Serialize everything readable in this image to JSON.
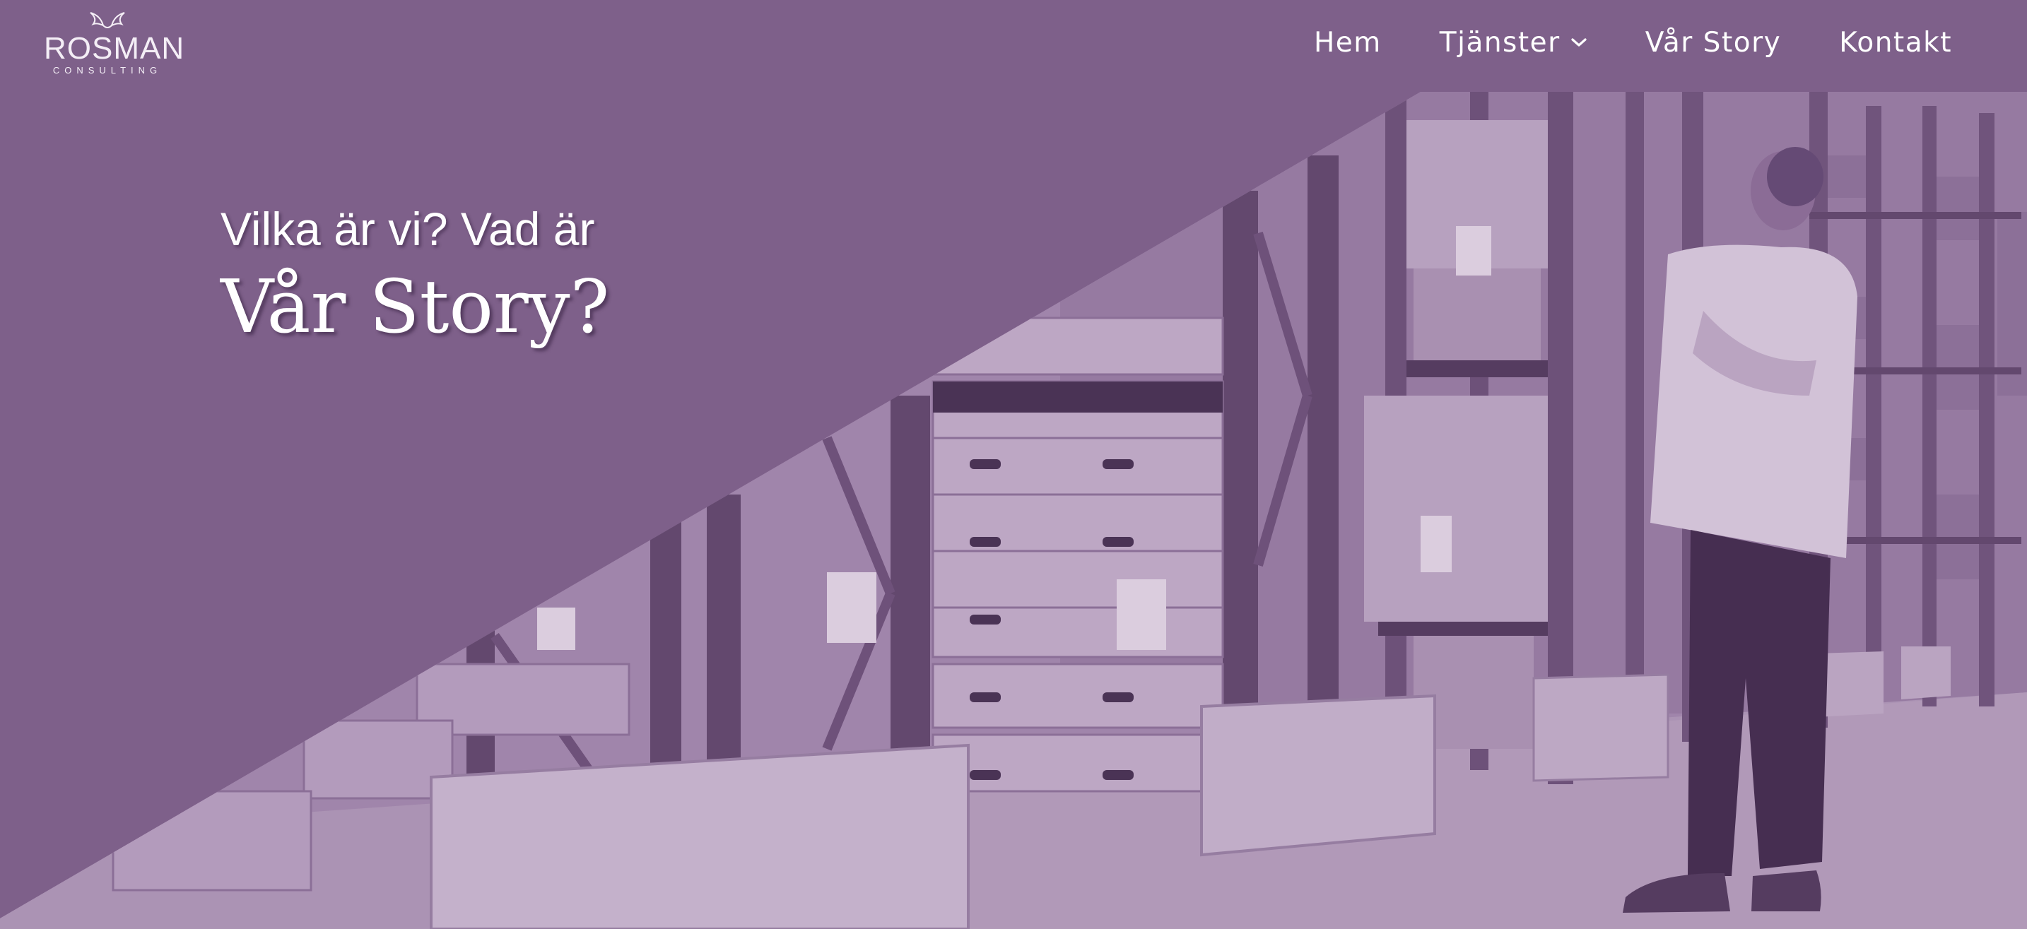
{
  "brand": {
    "name": "ROSMAN",
    "tagline": "CONSULTING"
  },
  "nav": {
    "items": [
      {
        "label": "Hem"
      },
      {
        "label": "Tjänster",
        "icon": "chevron-down-icon"
      },
      {
        "label": "Vår Story"
      },
      {
        "label": "Kontakt"
      }
    ]
  },
  "hero": {
    "kicker": "Vilka är vi? Vad är",
    "title": "Vår Story?",
    "image": "warehouse-photo"
  },
  "colors": {
    "brand_purple": "#7e608a",
    "photo_tint_light": "#c8b3cf",
    "photo_tint_dark": "#3f2a4a",
    "text": "#ffffff"
  }
}
